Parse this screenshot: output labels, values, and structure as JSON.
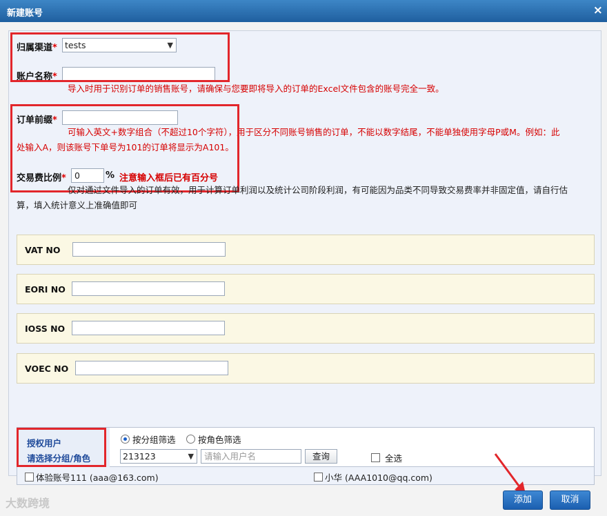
{
  "window": {
    "title": "新建账号",
    "close_icon": "×"
  },
  "form": {
    "channel": {
      "label": "归属渠道",
      "required": "*",
      "value": "tests"
    },
    "account_name": {
      "label": "账户名称",
      "required": "*",
      "value": "",
      "hint": "导入时用于识别订单的销售账号，请确保与您要即将导入的订单的Excel文件包含的账号完全一致。"
    },
    "order_prefix": {
      "label": "订单前缀",
      "required": "*",
      "value": "",
      "hint_line1": "可输入英文+数字组合（不超过10个字符），用于区分不同账号销售的订单，不能以数字结尾，不能单独使用字母P或M。例如：此",
      "hint_line2": "处输入A，则该账号下单号为101的订单将显示为A101。"
    },
    "fee_ratio": {
      "label": "交易费比例",
      "required": "*",
      "value": "0",
      "unit": "%",
      "note": "注意输入框后已有百分号",
      "hint_line1": "仅对通过文件导入的订单有效，用于计算订单利润以及统计公司阶段利润，有可能因为品类不同导致交易费率并非固定值，请自行估",
      "hint_line2": "算，填入统计意义上准确值即可"
    },
    "vat": {
      "label": "VAT NO",
      "value": ""
    },
    "eori": {
      "label": "EORI NO",
      "value": ""
    },
    "ioss": {
      "label": "IOSS NO",
      "value": ""
    },
    "voec": {
      "label": "VOEC NO",
      "value": ""
    }
  },
  "auth": {
    "label1": "授权用户",
    "label2": "请选择分组/角色",
    "radio_group": "按分组筛选",
    "radio_role": "按角色筛选",
    "group_value": "213123",
    "user_placeholder": "请输入用户名",
    "query_button": "查询",
    "select_all": "全选",
    "users": [
      "体验账号111 (aaa@163.com)",
      "小华 (AAA1010@qq.com)"
    ]
  },
  "buttons": {
    "add": "添加",
    "cancel": "取消"
  },
  "watermark": "大数跨境",
  "colors": {
    "titlebar": "#2a6db0",
    "required": "#e00000",
    "highlight_box": "#e2262b",
    "hint": "#d60000",
    "field_bg": "#fbf8e4",
    "button": "#1f63b5"
  }
}
